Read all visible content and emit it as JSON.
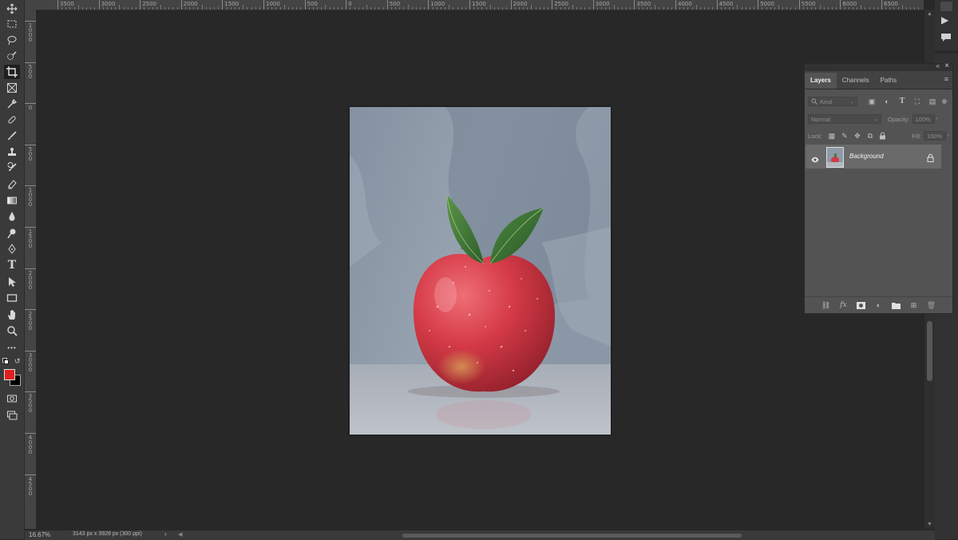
{
  "hruler": {
    "labels": [
      "3500",
      "3000",
      "2500",
      "2000",
      "1500",
      "1000",
      "500",
      "0",
      "500",
      "1000",
      "1500",
      "2000",
      "2500",
      "3000",
      "3500",
      "4000",
      "4500",
      "5000",
      "5500",
      "6000",
      "6500"
    ]
  },
  "vruler": {
    "labels": [
      "1 0 0 0",
      "5 0 0",
      "0",
      "5 0 0",
      "1 0 0 0",
      "1 5 0 0",
      "2 0 0 0",
      "2 5 0 0",
      "3 0 0 0",
      "3 5 0 0",
      "4 0 0 0",
      "4 5 0 0"
    ]
  },
  "toolbar": {
    "tools": [
      "move-tool",
      "marquee-tool",
      "lasso-tool",
      "quick-selection-tool",
      "crop-tool",
      "frame-tool",
      "eyedropper-tool",
      "healing-brush-tool",
      "brush-tool",
      "clone-stamp-tool",
      "history-brush-tool",
      "eraser-tool",
      "gradient-tool",
      "blur-tool",
      "dodge-tool",
      "pen-tool",
      "type-tool",
      "path-selection-tool",
      "rectangle-tool",
      "hand-tool",
      "zoom-tool",
      "more-tools"
    ],
    "type_tool_glyph": "T",
    "more_glyph": "•••",
    "foreground_color": "#e02020",
    "background_color": "#000000"
  },
  "status": {
    "zoom": "16.67%",
    "doc_info": "3143 px x 3928 px (300 ppi)",
    "arrow": "›"
  },
  "layers_panel": {
    "tabs": [
      "Layers",
      "Channels",
      "Paths"
    ],
    "active_tab": "Layers",
    "kind_label": "Kind",
    "blend_mode": "Normal",
    "opacity_label": "Opacity:",
    "opacity_value": "100%",
    "lock_label": "Lock:",
    "fill_label": "Fill:",
    "fill_value": "100%",
    "layers": [
      {
        "name": "Background",
        "visible": true,
        "locked": true
      }
    ]
  },
  "colors": {
    "canvas_bg": "#282828",
    "panel_bg": "#535353",
    "selected_layer": "#6a6a6a",
    "photo_wall": "#8c98a6",
    "apple_red": "#d23a46",
    "leaf_green": "#3f7a35"
  }
}
